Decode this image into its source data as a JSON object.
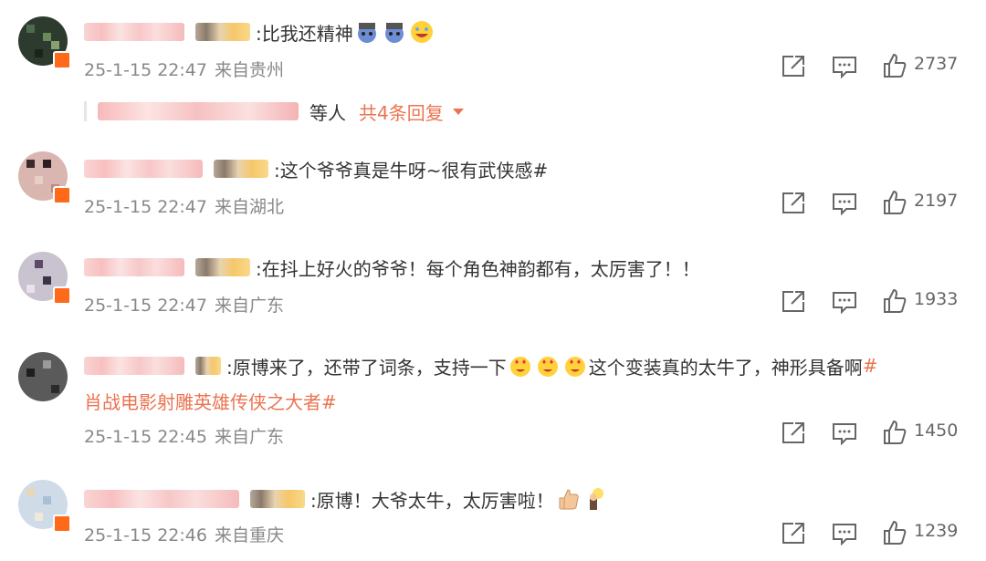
{
  "comments": [
    {
      "text": ":比我还精神",
      "emojis": [
        "fighting-emoji",
        "fighting-emoji",
        "laugh-cry-emoji"
      ],
      "date": "25-1-15 22:47",
      "location": "来自贵州",
      "likes": "2737",
      "replies": {
        "suffix": "等人",
        "more": "共4条回复"
      }
    },
    {
      "text": ":这个爷爷真是牛呀~很有武侠感#",
      "emojis": [],
      "date": "25-1-15 22:47",
      "location": "来自湖北",
      "likes": "2197"
    },
    {
      "text": ":在抖上好火的爷爷！每个角色神韵都有，太厉害了！！",
      "emojis": [],
      "date": "25-1-15 22:47",
      "location": "来自广东",
      "likes": "1933"
    },
    {
      "text_a": ":原博来了，还带了词条，支持一下",
      "emojis": [
        "love-eyes-emoji",
        "love-eyes-emoji",
        "love-eyes-emoji"
      ],
      "text_b": "这个变装真的太牛了，神形具备啊",
      "hashtag_a": "#",
      "hashtag_b": "肖战电影射雕英雄传侠之大者#",
      "date": "25-1-15 22:45",
      "location": "来自广东",
      "likes": "1450"
    },
    {
      "text": ":原博！大爷太牛，太厉害啦！",
      "emojis": [
        "thumbs-up-emoji",
        "idea-emoji"
      ],
      "date": "25-1-15 22:46",
      "location": "来自重庆",
      "likes": "1239"
    }
  ],
  "colors": {
    "accent": "#eb7350",
    "meta": "#888888",
    "text": "#333333"
  },
  "icons": {
    "share": "share-icon",
    "comment": "comment-icon",
    "like": "like-icon"
  }
}
